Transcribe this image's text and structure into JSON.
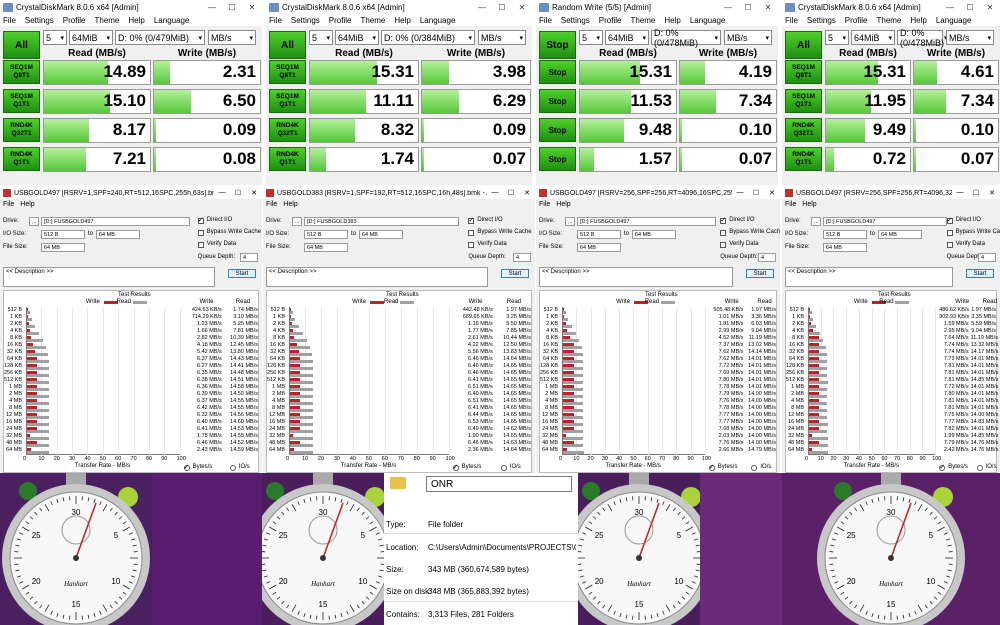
{
  "cdm": [
    {
      "title": "CrystalDiskMark 8.0.6 x64 [Admin]",
      "btn": "All",
      "row_btn": "",
      "count": "5",
      "size": "64MiB",
      "drive": "D: 0% (0/479MiB)",
      "unit": "MB/s",
      "read_hdr": "Read (MB/s)",
      "write_hdr": "Write (MB/s)",
      "rows": [
        {
          "l1": "SEQ1M",
          "l2": "Q8T1",
          "r": "14.89",
          "w": "2.31",
          "rf": 0.6,
          "wf": 0.15
        },
        {
          "l1": "SEQ1M",
          "l2": "Q1T1",
          "r": "15.10",
          "w": "6.50",
          "rf": 0.62,
          "wf": 0.35
        },
        {
          "l1": "RND4K",
          "l2": "Q32T1",
          "r": "8.17",
          "w": "0.09",
          "rf": 0.42,
          "wf": 0.02
        },
        {
          "l1": "RND4K",
          "l2": "Q1T1",
          "r": "7.21",
          "w": "0.08",
          "rf": 0.4,
          "wf": 0.02
        }
      ]
    },
    {
      "title": "CrystalDiskMark 8.0.6 x64 [Admin]",
      "btn": "All",
      "row_btn": "",
      "count": "5",
      "size": "64MiB",
      "drive": "D: 0% (0/384MiB)",
      "unit": "MB/s",
      "read_hdr": "Read (MB/s)",
      "write_hdr": "Write (MB/s)",
      "rows": [
        {
          "l1": "SEQ1M",
          "l2": "Q8T1",
          "r": "15.31",
          "w": "3.98",
          "rf": 0.62,
          "wf": 0.25
        },
        {
          "l1": "SEQ1M",
          "l2": "Q1T1",
          "r": "11.11",
          "w": "6.29",
          "rf": 0.52,
          "wf": 0.34
        },
        {
          "l1": "RND4K",
          "l2": "Q32T1",
          "r": "8.32",
          "w": "0.09",
          "rf": 0.42,
          "wf": 0.02
        },
        {
          "l1": "RND4K",
          "l2": "Q1T1",
          "r": "1.74",
          "w": "0.07",
          "rf": 0.15,
          "wf": 0.02
        }
      ]
    },
    {
      "title": "Random Write (5/5) [Admin]",
      "btn": "Stop",
      "row_btn": "Stop",
      "count": "5",
      "size": "64MiB",
      "drive": "D: 0% (0/478MiB)",
      "unit": "MB/s",
      "read_hdr": "Read (MB/s)",
      "write_hdr": "Write (MB/s)",
      "rows": [
        {
          "l1": "Stop",
          "l2": "",
          "r": "15.31",
          "w": "4.19",
          "rf": 0.62,
          "wf": 0.26
        },
        {
          "l1": "Stop",
          "l2": "",
          "r": "11.53",
          "w": "7.34",
          "rf": 0.53,
          "wf": 0.38
        },
        {
          "l1": "Stop",
          "l2": "",
          "r": "9.48",
          "w": "0.10",
          "rf": 0.46,
          "wf": 0.02
        },
        {
          "l1": "Stop",
          "l2": "",
          "r": "1.57",
          "w": "0.07",
          "rf": 0.15,
          "wf": 0.02
        }
      ]
    },
    {
      "title": "CrystalDiskMark 8.0.6 x64 [Admin]",
      "btn": "All",
      "row_btn": "",
      "count": "5",
      "size": "64MiB",
      "drive": "D: 0% (0/478MiB)",
      "unit": "MB/s",
      "read_hdr": "Read (MB/s)",
      "write_hdr": "Write (MB/s)",
      "rows": [
        {
          "l1": "SEQ1M",
          "l2": "Q8T1",
          "r": "15.31",
          "w": "4.61",
          "rf": 0.62,
          "wf": 0.27
        },
        {
          "l1": "SEQ1M",
          "l2": "Q1T1",
          "r": "11.95",
          "w": "7.34",
          "rf": 0.54,
          "wf": 0.38
        },
        {
          "l1": "RND4K",
          "l2": "Q32T1",
          "r": "9.49",
          "w": "0.10",
          "rf": 0.46,
          "wf": 0.02
        },
        {
          "l1": "RND4K",
          "l2": "Q1T1",
          "r": "0.72",
          "w": "0.07",
          "rf": 0.1,
          "wf": 0.02
        }
      ]
    }
  ],
  "cdm_menu": {
    "file": "File",
    "settings": "Settings",
    "profile": "Profile",
    "theme": "Theme",
    "help": "Help",
    "language": "Language"
  },
  "atto_labels": {
    "file": "File",
    "help": "Help",
    "drive": "Drive:",
    "io_size": "I/O Size:",
    "to": "to",
    "file_size": "File Size:",
    "direct_io": "Direct I/O",
    "bypass": "Bypass Write Cache",
    "verify": "Verify Data",
    "queue": "Queue Depth:",
    "queue_val": "4",
    "desc": "<< Description >>",
    "start": "Start",
    "test_results": "Test Results",
    "write": "Write",
    "read": "Read",
    "xaxis": "Transfer Rate - MB/s",
    "bytes": "Bytes/s",
    "ios": "IO/s"
  },
  "atto": [
    {
      "title": "USBGOLD497 [RSRV=1,SPF=240,RT=512,16SPC,255h,63s].bmk - AT...",
      "drive": "[D:] FUSBGOLD497",
      "io_from": "512 B",
      "io_to": "64 MB",
      "fsize": "64 MB",
      "write": [
        "424.63 KB/s",
        "714.29 KB/s",
        "1.23 MB/s",
        "1.66 MB/s",
        "2.82 MB/s",
        "4.18 MB/s",
        "5.42 MB/s",
        "6.37 MB/s",
        "6.27 MB/s",
        "6.35 MB/s",
        "6.38 MB/s",
        "6.36 MB/s",
        "6.39 MB/s",
        "6.37 MB/s",
        "6.42 MB/s",
        "6.32 MB/s",
        "6.40 MB/s",
        "6.41 MB/s",
        "1.78 MB/s",
        "6.46 MB/s",
        "2.43 MB/s"
      ],
      "read": [
        "1.74 MB/s",
        "3.10 MB/s",
        "5.25 MB/s",
        "7.81 MB/s",
        "10.39 MB/s",
        "12.45 MB/s",
        "13.80 MB/s",
        "14.43 MB/s",
        "14.41 MB/s",
        "14.48 MB/s",
        "14.51 MB/s",
        "14.58 MB/s",
        "14.50 MB/s",
        "14.55 MB/s",
        "14.55 MB/s",
        "14.56 MB/s",
        "14.60 MB/s",
        "14.53 MB/s",
        "14.55 MB/s",
        "14.52 MB/s",
        "14.59 MB/s"
      ]
    },
    {
      "title": "USBGOLD383 [RSRV=1,SPF=192,RT=512,16SPC,16h,48s].bmk - ATT...",
      "drive": "[D:] FUSBGOLD383",
      "io_from": "512 B",
      "io_to": "64 MB",
      "fsize": "64 MB",
      "write": [
        "442.48 KB/s",
        "689.65 KB/s",
        "1.16 MB/s",
        "1.77 MB/s",
        "2.61 MB/s",
        "4.22 MB/s",
        "5.56 MB/s",
        "6.46 MB/s",
        "6.46 MB/s",
        "6.46 MB/s",
        "6.41 MB/s",
        "6.51 MB/s",
        "6.40 MB/s",
        "6.51 MB/s",
        "6.41 MB/s",
        "6.44 MB/s",
        "6.53 MB/s",
        "6.49 MB/s",
        "1.90 MB/s",
        "6.46 MB/s",
        "2.36 MB/s"
      ],
      "read": [
        "1.97 MB/s",
        "3.25 MB/s",
        "5.50 MB/s",
        "7.85 MB/s",
        "10.44 MB/s",
        "12.50 MB/s",
        "13.83 MB/s",
        "14.64 MB/s",
        "14.65 MB/s",
        "14.65 MB/s",
        "14.65 MB/s",
        "14.65 MB/s",
        "14.65 MB/s",
        "14.65 MB/s",
        "14.65 MB/s",
        "14.65 MB/s",
        "14.65 MB/s",
        "14.62 MB/s",
        "14.65 MB/s",
        "14.63 MB/s",
        "14.64 MB/s"
      ]
    },
    {
      "title": "USBGOLD497 [RSRV=256,SPF=256,RT=4096,16SPC,255h,63s].bmk - ...",
      "drive": "[D:] FUSBGOLD497",
      "io_from": "512 B",
      "io_to": "64 MB",
      "fsize": "64 MB",
      "write": [
        "505.48 KB/s",
        "1.01 MB/s",
        "1.81 MB/s",
        "2.99 MB/s",
        "4.62 MB/s",
        "7.37 MB/s",
        "7.62 MB/s",
        "7.62 MB/s",
        "7.72 MB/s",
        "7.69 MB/s",
        "7.80 MB/s",
        "7.78 MB/s",
        "7.79 MB/s",
        "7.76 MB/s",
        "7.78 MB/s",
        "7.77 MB/s",
        "7.77 MB/s",
        "7.68 MB/s",
        "2.03 MB/s",
        "7.76 MB/s",
        "2.66 MB/s"
      ],
      "read": [
        "1.97 MB/s",
        "3.36 MB/s",
        "6.03 MB/s",
        "9.04 MB/s",
        "11.19 MB/s",
        "13.02 MB/s",
        "14.14 MB/s",
        "14.01 MB/s",
        "14.01 MB/s",
        "14.01 MB/s",
        "14.01 MB/s",
        "14.01 MB/s",
        "14.00 MB/s",
        "14.00 MB/s",
        "14.00 MB/s",
        "14.00 MB/s",
        "14.00 MB/s",
        "14.00 MB/s",
        "14.00 MB/s",
        "14.00 MB/s",
        "14.79 MB/s"
      ]
    },
    {
      "title": "USBGOLD497 [RSRV=256,SPF=256,RT=4096,32SPC,255h,63s].bmk - ...",
      "drive": "[D:] FUSBGOLD497",
      "io_from": "512 B",
      "io_to": "64 MB",
      "fsize": "64 MB",
      "write": [
        "486.62 KB/s",
        "902.93 KB/s",
        "1.59 MB/s",
        "2.95 MB/s",
        "7.64 MB/s",
        "7.74 MB/s",
        "7.74 MB/s",
        "7.73 MB/s",
        "7.81 MB/s",
        "7.81 MB/s",
        "7.81 MB/s",
        "7.72 MB/s",
        "7.80 MB/s",
        "7.81 MB/s",
        "7.81 MB/s",
        "7.75 MB/s",
        "7.77 MB/s",
        "7.82 MB/s",
        "1.99 MB/s",
        "7.79 MB/s",
        "2.42 MB/s"
      ],
      "read": [
        "1.97 MB/s",
        "3.35 MB/s",
        "5.59 MB/s",
        "9.04 MB/s",
        "11.19 MB/s",
        "13.32 MB/s",
        "14.17 MB/s",
        "14.01 MB/s",
        "14.01 MB/s",
        "14.01 MB/s",
        "14.85 MB/s",
        "14.01 MB/s",
        "14.01 MB/s",
        "14.01 MB/s",
        "14.01 MB/s",
        "14.00 MB/s",
        "14.83 MB/s",
        "14.01 MB/s",
        "14.85 MB/s",
        "14.76 MB/s",
        "14.76 MB/s"
      ]
    }
  ],
  "atto_sizes": [
    "512 B",
    "1 KB",
    "2 KB",
    "4 KB",
    "8 KB",
    "16 KB",
    "32 KB",
    "64 KB",
    "128 KB",
    "256 KB",
    "512 KB",
    "1 MB",
    "2 MB",
    "4 MB",
    "8 MB",
    "12 MB",
    "16 MB",
    "24 MB",
    "32 MB",
    "48 MB",
    "64 MB"
  ],
  "atto_ticks": [
    "0",
    "10",
    "20",
    "30",
    "40",
    "50",
    "60",
    "70",
    "80",
    "90",
    "100"
  ],
  "props": {
    "name": "ONR",
    "type_l": "Type:",
    "type_v": "File folder",
    "loc_l": "Location:",
    "loc_v": "C:\\Users\\Admin\\Documents\\PROJECTS\\Grub4Dos",
    "size_l": "Size:",
    "size_v": "343 MB (360,674,589 bytes)",
    "sod_l": "Size on disk:",
    "sod_v": "348 MB (365,883,392 bytes)",
    "cont_l": "Contains:",
    "cont_v": "3,313 Files, 281 Folders"
  },
  "watch": {
    "brand": "Hanhart",
    "nums": [
      "30",
      "5",
      "10",
      "15",
      "20",
      "25"
    ],
    "small": [
      "27",
      "26",
      "29"
    ]
  },
  "colors": {
    "green": "#2aa81c",
    "write": "#c0202a",
    "read": "#a0a0a0"
  }
}
